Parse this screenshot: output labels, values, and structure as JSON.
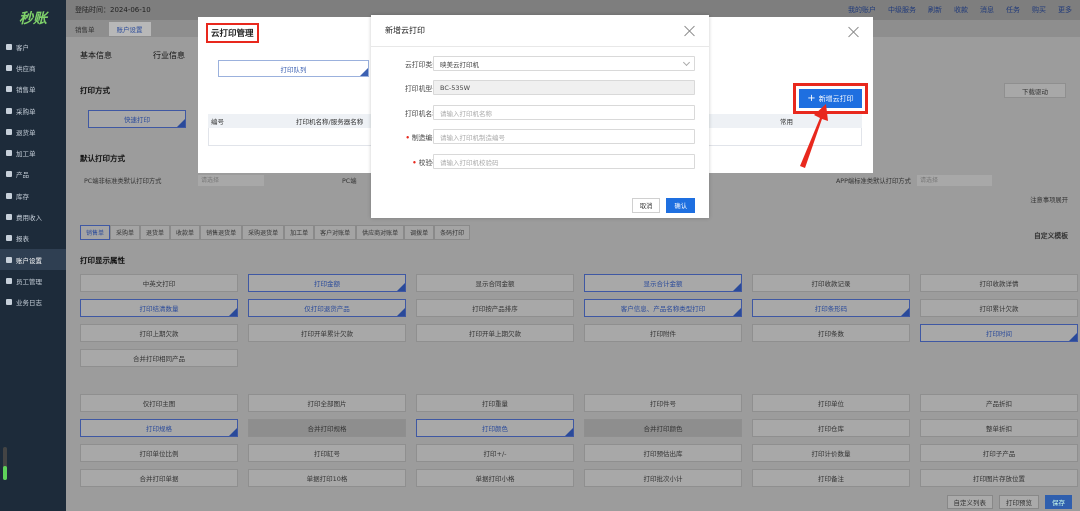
{
  "app": {
    "logo": "秒账",
    "login_time": "登陆时间：2024-06-10"
  },
  "topbar": {
    "right": [
      "我的账户",
      "中级服务",
      "刷新",
      "收款",
      "消息",
      "任务",
      "购买",
      "更多"
    ]
  },
  "tabs": [
    "销售单",
    "账户设置"
  ],
  "sidebar": {
    "items": [
      "客户",
      "供应商",
      "销售单",
      "采购单",
      "退货单",
      "加工单",
      "产品",
      "库存",
      "费用收入",
      "报表",
      "账户设置",
      "员工管理",
      "业务日志"
    ]
  },
  "main": {
    "tabs": [
      "基本信息",
      "行业信息"
    ],
    "print_mode": "打印方式",
    "quick_print": "快速打印",
    "download_driver": "下载驱动",
    "default_print": "默认打印方式",
    "pc_default": "PC端非标准类默认打印方式",
    "pc_default2": "PC端",
    "app_default": "APP端标准类默认打印方式",
    "select_ph": "请选择",
    "notes_expand": "注意事项展开",
    "doc_tabs": [
      "销售单",
      "采购单",
      "退货单",
      "收款单",
      "销售退货单",
      "采购退货单",
      "加工单",
      "客户对账单",
      "供应商对账单",
      "调拨单",
      "条码打印"
    ],
    "custom_template": "自定义模板",
    "display_attr": "打印显示属性",
    "grid1": [
      "中英文打印",
      "打印金额",
      "显示合同金额",
      "显示合计金额",
      "打印收款记录",
      "打印收款详情",
      "打印结清数量",
      "仅打印退货产品",
      "打印按产品排序",
      "客户信息、产品名称类型打印",
      "打印条形码",
      "打印累计欠款",
      "打印上期欠款",
      "打印开单累计欠款",
      "打印开单上期欠款",
      "打印附件",
      "打印条数",
      "打印时间",
      "合并打印相同产品"
    ],
    "grid2": [
      "仅打印主图",
      "打印全部图片",
      "打印重量",
      "打印件号",
      "打印单位",
      "产品折扣",
      "打印规格",
      "合并打印规格",
      "打印颜色",
      "合并打印颜色",
      "打印仓库",
      "整单折扣",
      "打印单位比例",
      "打印缸号",
      "打印+/-",
      "打印预估出库",
      "打印计价数量",
      "打印子产品",
      "合并打印单据",
      "单据打印10格",
      "单据打印小格",
      "打印批次小计",
      "打印备注",
      "打印图片存放位置"
    ],
    "footer": [
      "自定义列表",
      "打印预览",
      "保存"
    ]
  },
  "dialog_cloud": {
    "title": "云打印管理",
    "tab": "打印队列",
    "columns": [
      "编号",
      "打印机名称/服务器名称",
      "常用"
    ],
    "add_button": "新增云打印"
  },
  "dialog_add": {
    "title": "新增云打印",
    "fields": [
      {
        "label": "云打印类型",
        "value": "映美云打印机",
        "required": false
      },
      {
        "label": "打印机型号",
        "value": "BC-535W",
        "required": false
      },
      {
        "label": "打印机名称",
        "placeholder": "请输入打印机名称",
        "required": false
      },
      {
        "label": "制造编号",
        "placeholder": "请输入打印机制造编号",
        "required": true
      },
      {
        "label": "校验码",
        "placeholder": "请输入打印机校验码",
        "required": true
      }
    ],
    "cancel": "取消",
    "confirm": "确认"
  },
  "colors": {
    "primary": "#1e6fe0",
    "highlight": "#e8281d",
    "sidebar": "#1d2b3a"
  }
}
